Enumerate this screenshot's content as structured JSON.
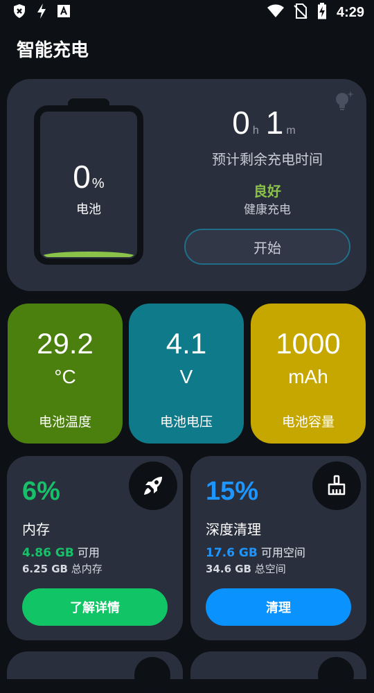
{
  "status_bar": {
    "time": "4:29",
    "left_icons": [
      "shield-x-icon",
      "flash-icon",
      "text-a-icon"
    ],
    "right_icons": [
      "wifi-icon",
      "no-sim-icon",
      "battery-charging-icon"
    ]
  },
  "page": {
    "title": "智能充电"
  },
  "battery": {
    "percent": "0",
    "percent_unit": "%",
    "label": "电池",
    "fill_level_percent": 0,
    "fill_color": "#8bc34a",
    "remaining_hours": "0",
    "hours_unit": "h",
    "remaining_minutes": "1",
    "minutes_unit": "m",
    "remaining_caption": "预计剩余充电时间",
    "health_value": "良好",
    "health_label": "健康充电",
    "start_button": "开始"
  },
  "tiles": {
    "temperature": {
      "value": "29.2",
      "unit": "°C",
      "label": "电池温度",
      "color": "#4b7f0e"
    },
    "voltage": {
      "value": "4.1",
      "unit": "V",
      "label": "电池电压",
      "color": "#0e7a8a"
    },
    "capacity": {
      "value": "1000",
      "unit": "mAh",
      "label": "电池容量",
      "color": "#c5a700"
    }
  },
  "memory": {
    "percent": "6%",
    "title": "内存",
    "available_value": "4.86 GB",
    "available_label": "可用",
    "total_value": "6.25 GB",
    "total_label": "总内存",
    "button": "了解详情",
    "accent": "#18c06a",
    "icon": "rocket-icon"
  },
  "cleaner": {
    "percent": "15%",
    "title": "深度清理",
    "available_value": "17.6 GB",
    "available_label": "可用空间",
    "total_value": "34.6 GB",
    "total_label": "总空间",
    "button": "清理",
    "accent": "#1e96ff",
    "icon": "broom-icon"
  }
}
